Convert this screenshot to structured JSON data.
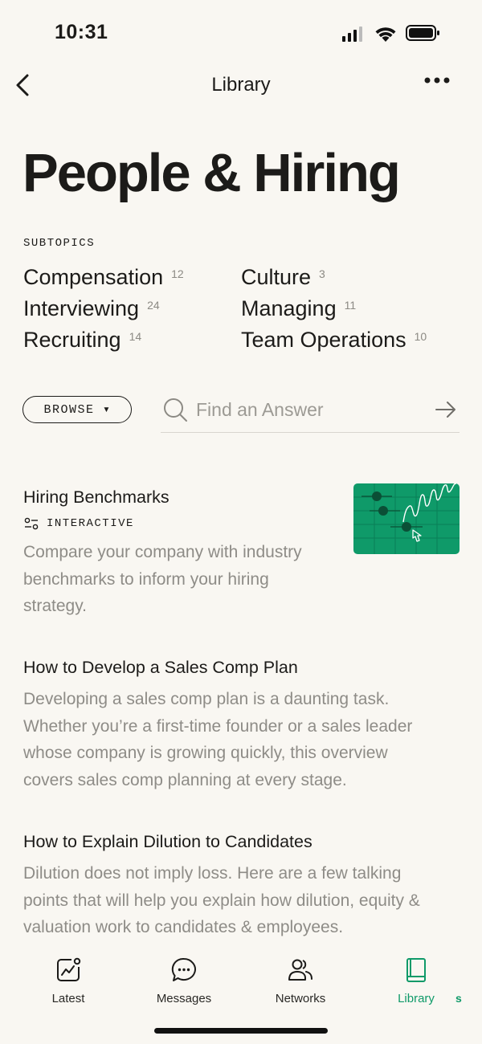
{
  "status_bar": {
    "time": "10:31"
  },
  "nav": {
    "title": "Library"
  },
  "page": {
    "title": "People & Hiring"
  },
  "subtopics": {
    "label": "SUBTOPICS",
    "items": [
      {
        "label": "Compensation",
        "count": "12"
      },
      {
        "label": "Culture",
        "count": "3"
      },
      {
        "label": "Interviewing",
        "count": "24"
      },
      {
        "label": "Managing",
        "count": "11"
      },
      {
        "label": "Recruiting",
        "count": "14"
      },
      {
        "label": "Team Operations",
        "count": "10"
      }
    ]
  },
  "browse": {
    "label": "BROWSE"
  },
  "search": {
    "placeholder": "Find an Answer"
  },
  "articles": [
    {
      "title": "Hiring Benchmarks",
      "tag": "INTERACTIVE",
      "desc_lines": [
        "Compare your company with industry",
        "benchmarks to inform your hiring",
        "strategy."
      ],
      "thumb_color": "#0f9a69"
    },
    {
      "title": "How to Develop a Sales Comp Plan",
      "desc_lines": [
        "Developing a sales comp plan is a daunting task.",
        "Whether you’re a first-time founder or a sales leader",
        "whose company is growing quickly, this overview",
        "covers sales comp planning at every stage."
      ]
    },
    {
      "title": "How to Explain Dilution to Candidates",
      "desc_lines": [
        "Dilution does not imply loss. Here are a few talking",
        "points that will help you explain how dilution, equity &",
        "valuation work to candidates & employees."
      ]
    }
  ],
  "tabbar": {
    "active": "Library",
    "accent": "#0f9a69",
    "tabs": [
      {
        "label": "Latest",
        "icon": "chart-badge-icon"
      },
      {
        "label": "Messages",
        "icon": "chat-bubble-icon"
      },
      {
        "label": "Networks",
        "icon": "people-icon"
      },
      {
        "label": "Library",
        "icon": "book-icon"
      }
    ],
    "partial_label": "s"
  }
}
